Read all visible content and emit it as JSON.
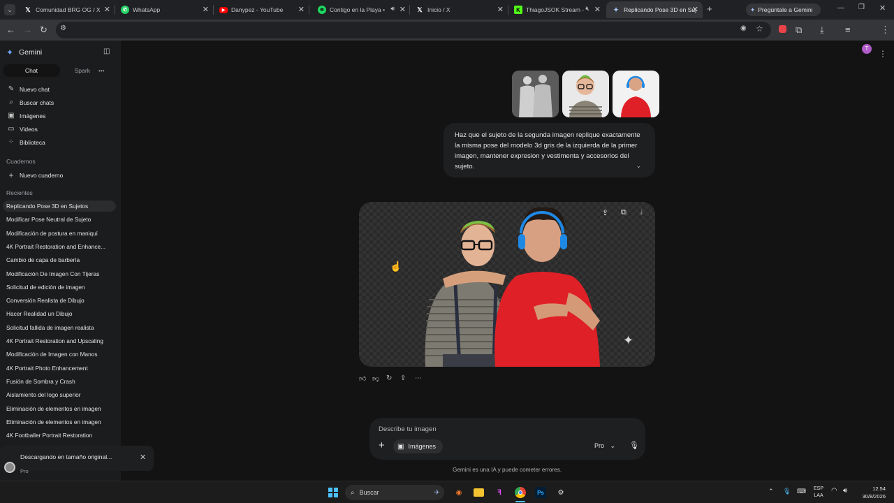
{
  "tabs": [
    {
      "label": "Comunidad BRG OG / X",
      "icon": "x-logo-icon"
    },
    {
      "label": "WhatsApp",
      "icon": "whatsapp-icon"
    },
    {
      "label": "Danypez - YouTube",
      "icon": "youtube-icon"
    },
    {
      "label": "Contigo en la Playa • ",
      "icon": "spotify-icon"
    },
    {
      "label": "Inicio / X",
      "icon": "x-logo-icon"
    },
    {
      "label": "ThiagoJSOK Stream - ",
      "icon": "kick-icon"
    },
    {
      "label": "Replicando Pose 3D en Suj",
      "icon": "gemini-icon"
    }
  ],
  "ask_gemini": "Pregúntale a Gemini",
  "sidebar": {
    "brand": "Gemini",
    "tab_chat": "Chat",
    "tab_spark": "Spark",
    "nav": [
      {
        "label": "Nuevo chat",
        "icon": "edit-icon"
      },
      {
        "label": "Buscar chats",
        "icon": "search-icon"
      },
      {
        "label": "Imágenes",
        "icon": "image-icon"
      },
      {
        "label": "Videos",
        "icon": "video-icon"
      },
      {
        "label": "Biblioteca",
        "icon": "library-icon"
      }
    ],
    "notebooks_heading": "Cuadernos",
    "new_notebook": "Nuevo cuaderno",
    "recents_heading": "Recientes",
    "recents": [
      "Replicando Pose 3D en Sujetos",
      "Modificar Pose Neutral de Sujeto",
      "Modificación de postura en maniquí",
      "4K Portrait Restoration and Enhance...",
      "Cambio de capa de barbería",
      "Modificación De Imagen Con Tijeras",
      "Solicitud de edición de imagen",
      "Conversión Realista de Dibujo",
      "Hacer Realidad un Dibujo",
      "Solicitud fallida de imagen realista",
      "4K Portrait Restoration and Upscaling",
      "Modificación de Imagen con Manos",
      "4K Portrait Photo Enhancement",
      "Fusión de Sombra y Crash",
      "Aislamiento del logo superior",
      "Eliminación de elementos en imagen",
      "Eliminación de elementos en imagen",
      "4K Footballer Portrait Restoration",
      "Pr"
    ],
    "download_toast": "Descargando en tamaño original...",
    "account_plan": "Pro"
  },
  "conversation": {
    "prompt": "Haz que el sujeto de la segunda imagen replique exactamente la misma pose del modelo 3d gris de la izquierda de la primer imagen, mantener expresion y vestimenta y accesorios del sujeto."
  },
  "composer": {
    "placeholder": "Describe tu imagen",
    "images_chip": "Imágenes",
    "model": "Pro"
  },
  "disclaimer": "Gemini es una IA y puede cometer errores.",
  "taskbar": {
    "search": "Buscar",
    "lang_top": "ESP",
    "lang_bottom": "LAA",
    "time": "12:54",
    "date": "30/8/2026"
  },
  "colors": {
    "accent": "#a8c7fa",
    "background": "#131314",
    "sidebar": "#1b1c1d"
  }
}
